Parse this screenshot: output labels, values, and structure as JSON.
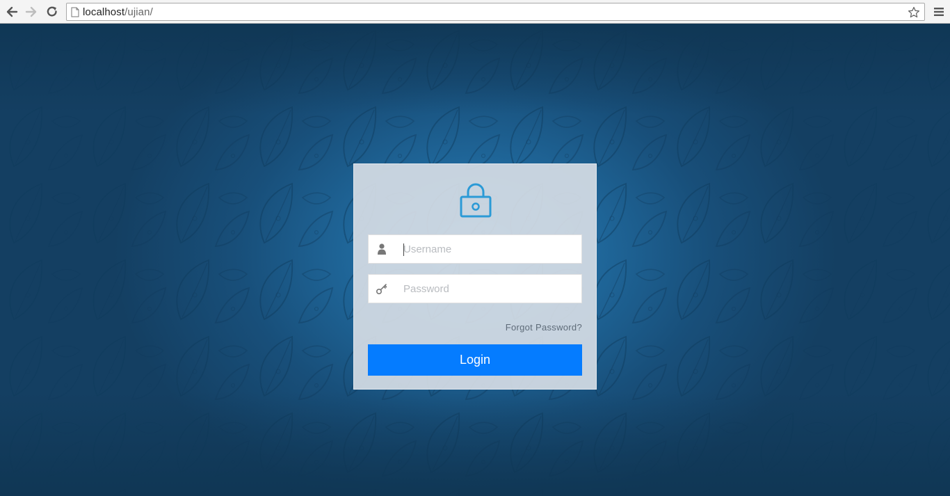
{
  "browser": {
    "url_host": "localhost",
    "url_path": "/ujian/",
    "icons": {
      "back": "back-arrow-icon",
      "forward": "forward-arrow-icon",
      "reload": "reload-icon",
      "page": "page-icon",
      "star": "bookmark-star-icon",
      "menu": "hamburger-menu-icon"
    }
  },
  "login": {
    "icons": {
      "lock": "lock-icon",
      "user": "user-icon",
      "key": "key-icon"
    },
    "username_placeholder": "Username",
    "password_placeholder": "Password",
    "forgot_label": "Forgot Password?",
    "login_label": "Login",
    "colors": {
      "accent": "#057cff",
      "lock": "#2b9ad6",
      "background": "#1f6699"
    }
  }
}
